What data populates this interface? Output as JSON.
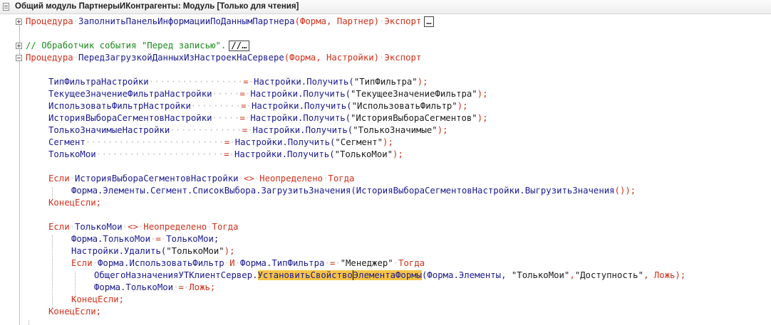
{
  "window": {
    "title": "Общий модуль ПартнерыИКонтрагенты: Модуль [Только для чтения]"
  },
  "editor": {
    "l1": {
      "kw": "Процедура",
      "name": "ЗаполнитьПанельИнформацииПоДаннымПартнера",
      "args": "(Форма, Партнер)",
      "export": "Экспорт",
      "collapsed": "…"
    },
    "l2": {
      "comment": "// Обработчик события \"Перед записью\".",
      "collapsed": "//…"
    },
    "l3": {
      "kw": "Процедура",
      "name": "ПередЗагрузкойДанныхИзНастроекНаСервере",
      "args": "(Форма, Настройки)",
      "export": "Экспорт"
    },
    "assign": [
      {
        "var": "ТипФильтраНастройки",
        "rhs": "Настройки.Получить(",
        "arg": "\"ТипФильтра\"",
        "end": ");"
      },
      {
        "var": "ТекущееЗначениеФильтраНастройки",
        "rhs": "Настройки.Получить(",
        "arg": "\"ТекущееЗначениеФильтра\"",
        "end": ");"
      },
      {
        "var": "ИспользоватьФильтрНастройки",
        "rhs": "Настройки.Получить(",
        "arg": "\"ИспользоватьФильтр\"",
        "end": ");"
      },
      {
        "var": "ИсторияВыбораСегментовНастройки",
        "rhs": "Настройки.Получить(",
        "arg": "\"ИсторияВыбораСегментов\"",
        "end": ");"
      },
      {
        "var": "ТолькоЗначимыеНастройки",
        "rhs": "Настройки.Получить(",
        "arg": "\"ТолькоЗначимые\"",
        "end": ");"
      },
      {
        "var": "Сегмент",
        "rhs": "Настройки.Получить(",
        "arg": "\"Сегмент\"",
        "end": ");"
      },
      {
        "var": "ТолькоМои",
        "rhs": "Настройки.Получить(",
        "arg": "\"ТолькоМои\"",
        "end": ");"
      }
    ],
    "if1": {
      "kw": "Если",
      "cond": "ИсторияВыбораСегментовНастройки",
      "op": "<>",
      "undef": "Неопределено",
      "then": "Тогда"
    },
    "if1body": {
      "a": "Форма.Элементы.Сегмент.СписокВыбора.ЗагрузитьЗначения(",
      "b": "ИсторияВыбораСегментовНастройки.ВыгрузитьЗначения",
      "c": "());"
    },
    "endif": "КонецЕсли;",
    "if2": {
      "kw": "Если",
      "cond": "ТолькоМои",
      "op": "<>",
      "undef": "Неопределено",
      "then": "Тогда"
    },
    "b1": {
      "a": "Форма.ТолькоМои",
      "op": "=",
      "b": "ТолькоМои;"
    },
    "b2": {
      "a": "Настройки.Удалить(",
      "arg": "\"ТолькоМои\"",
      "end": ");"
    },
    "if3": {
      "kw": "Если",
      "a": "Форма.ИспользоватьФильтр",
      "and": "И",
      "b": "Форма.ТипФильтра",
      "op": "=",
      "str": "\"Менеджер\"",
      "then": "Тогда"
    },
    "call": {
      "mod": "ОбщегоНазначенияУТКлиентСервер.",
      "hl1": "УстановитьСвойство",
      "hl2": "ЭлементаФормы",
      "args1": "(Форма.Элементы, ",
      "s1": "\"ТолькоМои\"",
      "comma": ",",
      "s2": "\"Доступность\"",
      "comma2": ", ",
      "lie": "Ложь",
      "end": ");"
    },
    "b3": {
      "a": "Форма.ТолькоМои",
      "op": "=",
      "lie": "Ложь",
      "end": ";"
    }
  }
}
